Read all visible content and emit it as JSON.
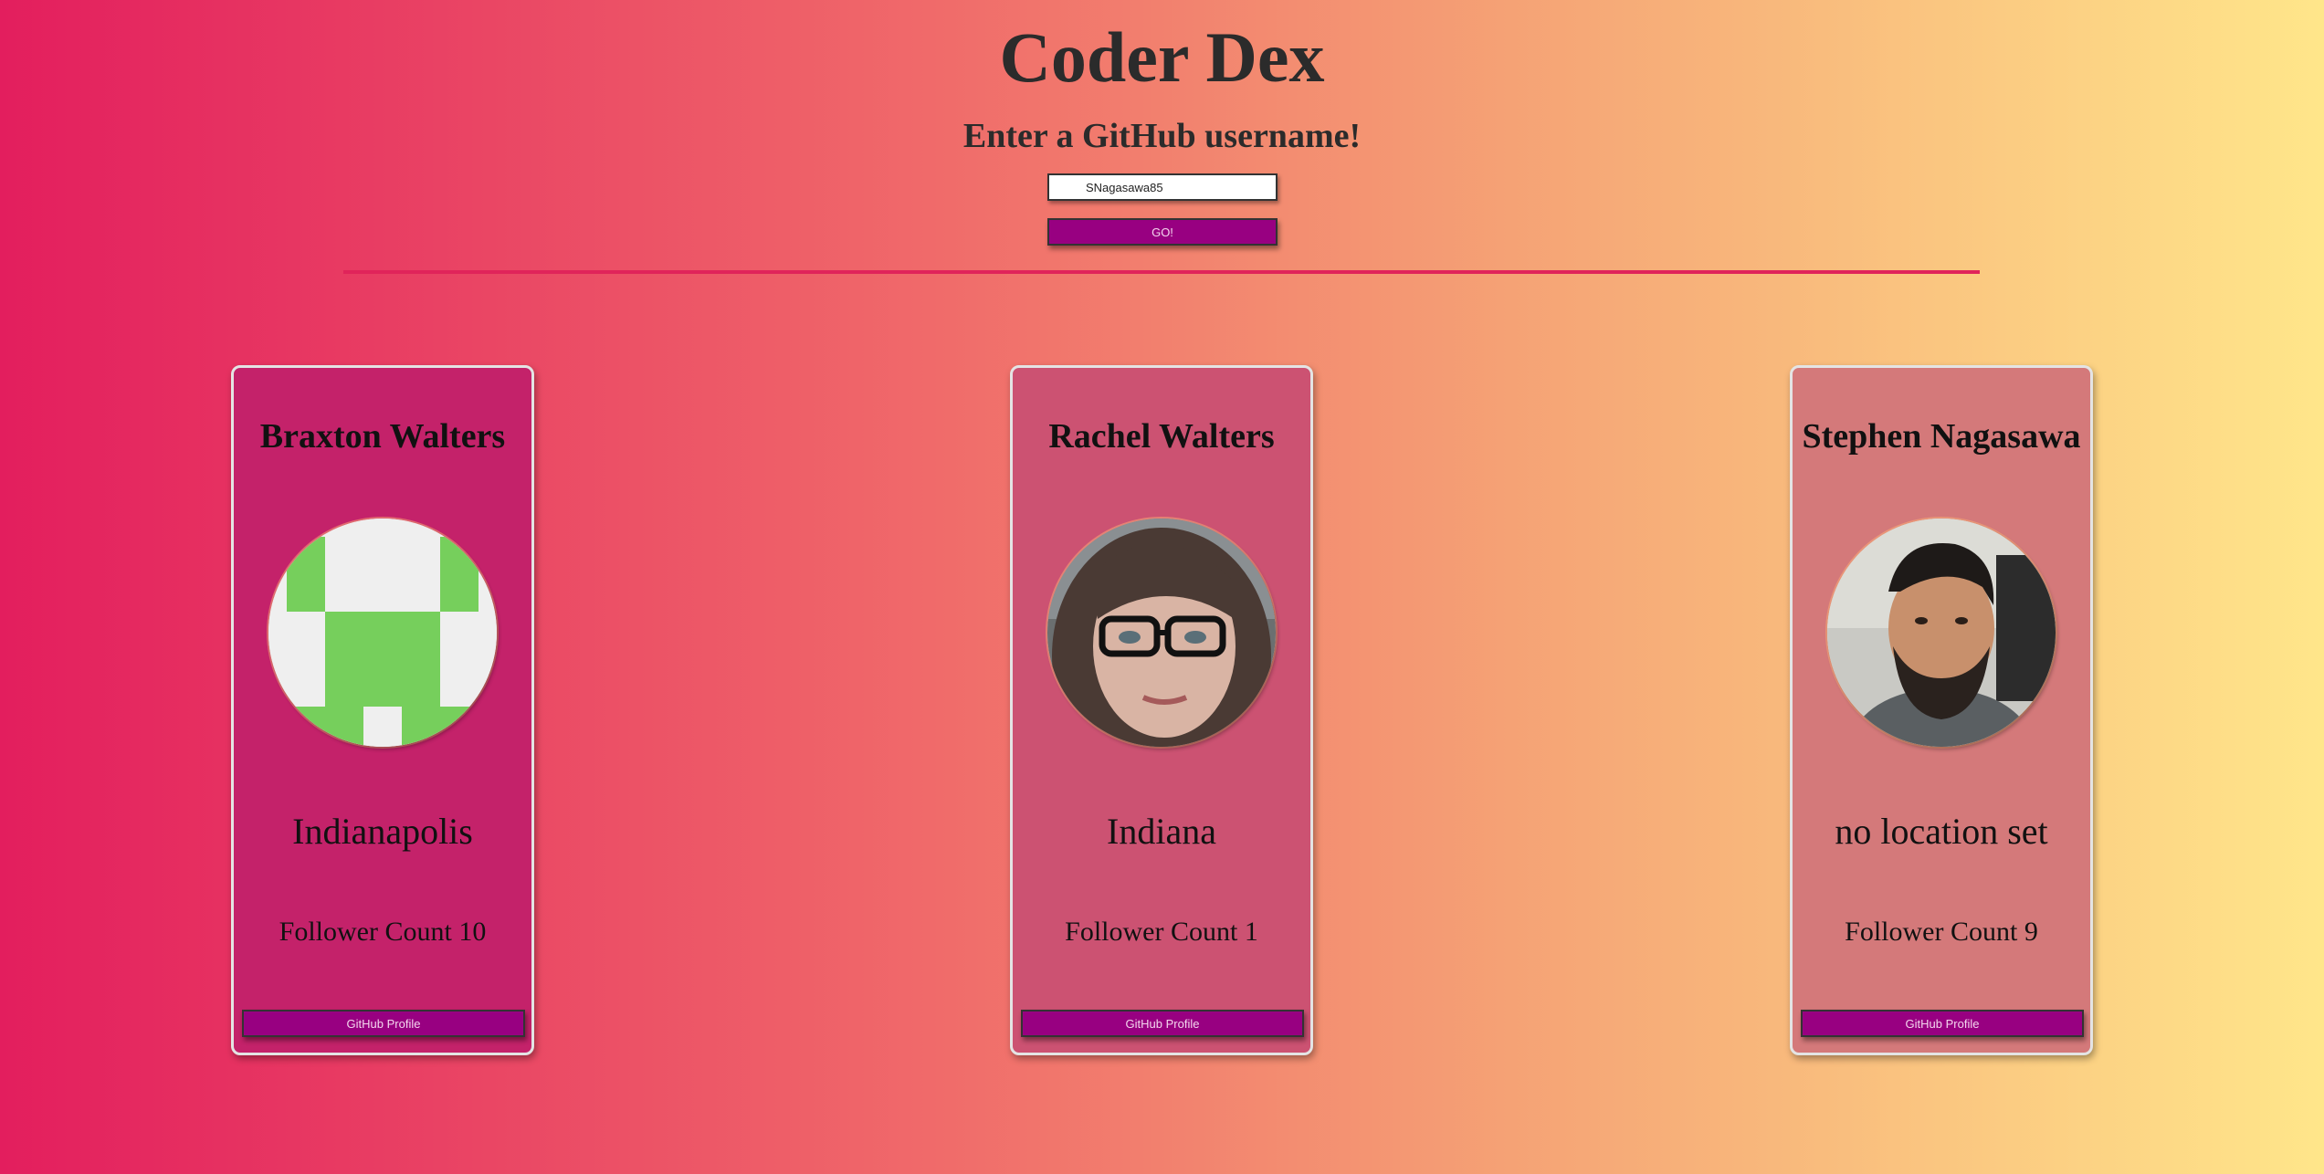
{
  "header": {
    "title": "Coder Dex",
    "subtitle": "Enter a GitHub username!"
  },
  "search": {
    "value": "SNagasawa85",
    "button_label": "GO!"
  },
  "cards": [
    {
      "name": "Braxton Walters",
      "location": "Indianapolis",
      "followers": "Follower Count 10",
      "button_label": "GitHub Profile",
      "avatar_icon": "identicon-avatar",
      "background": "#c4226a"
    },
    {
      "name": "Rachel Walters",
      "location": "Indiana",
      "followers": "Follower Count 1",
      "button_label": "GitHub Profile",
      "avatar_icon": "photo-avatar",
      "background": "#cc5272"
    },
    {
      "name": "Stephen Nagasawa",
      "location": "no location set",
      "followers": "Follower Count 9",
      "button_label": "GitHub Profile",
      "avatar_icon": "photo-avatar",
      "background": "#d4797a"
    }
  ],
  "colors": {
    "accent_button": "#980081",
    "divider": "#e0245a",
    "identicon_green": "#76cf5c"
  }
}
